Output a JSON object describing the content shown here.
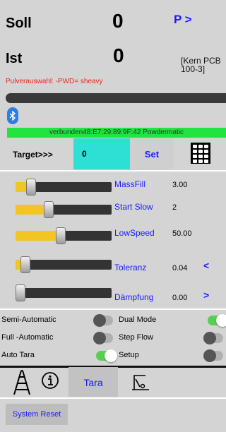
{
  "header": {
    "soll_label": "Soll",
    "soll_value": "0",
    "p_link": "P >",
    "ist_label": "Ist",
    "ist_value": "0",
    "scale_info": "[Kern PCB 100-3]",
    "powder_selection": "Pulverauswahl: -PWD= sheavy"
  },
  "connection": {
    "status": "verbunden48:E7:29:89:9F:42 Powdermatic",
    "icon": "bluetooth-icon"
  },
  "target": {
    "label": "Target>>>",
    "value": "0",
    "set_label": "Set",
    "keypad_icon": "keypad-icon"
  },
  "sliders": [
    {
      "name": "MassFill",
      "value": "3.00",
      "fill_fraction": 0.12,
      "arrow": ""
    },
    {
      "name": "Start Slow",
      "value": "2",
      "fill_fraction": 0.33,
      "arrow": ""
    },
    {
      "name": "LowSpeed",
      "value": "50.00",
      "fill_fraction": 0.47,
      "arrow": ""
    },
    {
      "name": "Toleranz",
      "value": "0.04",
      "fill_fraction": 0.06,
      "arrow": "<"
    },
    {
      "name": "Dämpfung",
      "value": "0.00",
      "fill_fraction": 0.0,
      "arrow": ">"
    }
  ],
  "toggles": {
    "semi_automatic": {
      "label": "Semi-Automatic",
      "on": false
    },
    "dual_mode": {
      "label": "Dual Mode",
      "on": true
    },
    "full_automatic": {
      "label": "Full -Automatic",
      "on": false
    },
    "step_flow": {
      "label": "Step Flow",
      "on": false
    },
    "auto_tara": {
      "label": "Auto Tara",
      "on": true
    },
    "setup": {
      "label": "Setup",
      "on": false
    }
  },
  "tabs": {
    "tara_label": "Tara",
    "icons": [
      "ladder-icon",
      "info-icon",
      "scale-icon"
    ]
  },
  "footer": {
    "reset_label": "System Reset"
  },
  "colors": {
    "accent": "#1a1aff",
    "connection_bar": "#22e33f",
    "target_input": "#2ee0d4",
    "slider_fill": "#f3c522",
    "warning_text": "#e8271f",
    "toggle_on": "#57d04f"
  }
}
